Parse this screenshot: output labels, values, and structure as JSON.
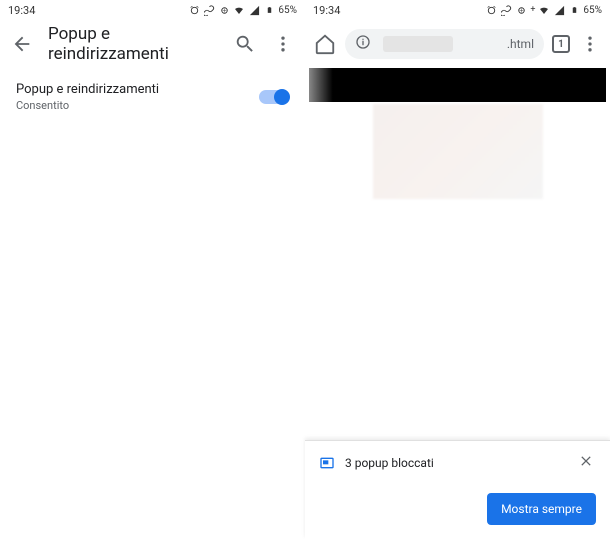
{
  "status": {
    "time": "19:34",
    "battery": "65%"
  },
  "left": {
    "title": "Popup e reindirizzamenti",
    "setting_title": "Popup e reindirizzamenti",
    "setting_sub": "Consentito"
  },
  "right": {
    "url_suffix": ".html",
    "tab_count": "1",
    "popup_msg": "3 popup bloccati",
    "action": "Mostra sempre"
  }
}
